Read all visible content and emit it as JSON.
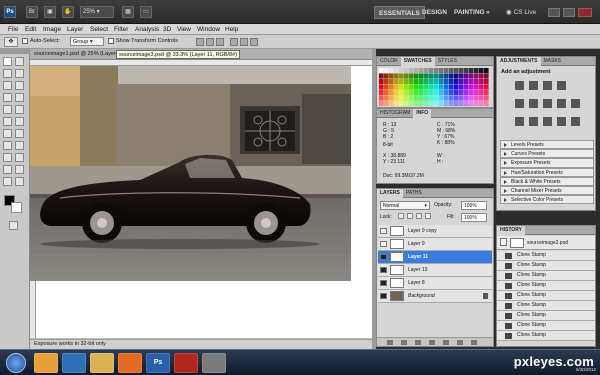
{
  "appbar": {
    "zoom": "25%",
    "workspaces": [
      "ESSENTIALS",
      "DESIGN",
      "PAINTING"
    ],
    "cs_live": "CS Live"
  },
  "menu": [
    "File",
    "Edit",
    "Image",
    "Layer",
    "Select",
    "Filter",
    "Analysis",
    "3D",
    "View",
    "Window",
    "Help"
  ],
  "options": {
    "auto_select_label": "Auto-Select:",
    "auto_select_value": "Group",
    "show_transform": "Show Transform Controls"
  },
  "document": {
    "tab_title": "sourceimage1.psd @ 25% (Layer 11, RGB/8#)",
    "tooltip": "sourceimage3.psd @ 33.3% (Layer 11, RGB/8#)",
    "status": "Exposure works in 32-bit only"
  },
  "swatches_panel": {
    "tabs": [
      "COLOR",
      "SWATCHES",
      "STYLES"
    ],
    "active": "SWATCHES"
  },
  "info_panel": {
    "tabs": [
      "HISTOGRAM",
      "INFO"
    ],
    "rgb": [
      [
        "R :",
        "13"
      ],
      [
        "G :",
        "5"
      ],
      [
        "B :",
        "2"
      ]
    ],
    "cmyk": [
      [
        "C :",
        "71%"
      ],
      [
        "M :",
        "68%"
      ],
      [
        "Y :",
        "67%"
      ],
      [
        "K :",
        "88%"
      ]
    ],
    "bits": "8-bit",
    "xy": [
      [
        "X :",
        "38.889"
      ],
      [
        "Y :",
        "23.111"
      ]
    ],
    "wh": [
      [
        "W :",
        ""
      ],
      [
        "H :",
        ""
      ]
    ],
    "doc": "Doc: 99.3M/37.2M"
  },
  "layers_panel": {
    "tabs": [
      "LAYERS",
      "PATHS"
    ],
    "blend_mode": "Normal",
    "opacity_label": "Opacity:",
    "opacity_value": "100%",
    "lock_label": "Lock:",
    "fill_label": "Fill:",
    "fill_value": "100%",
    "layers": [
      {
        "name": "Layer 9 copy",
        "visible": false,
        "selected": false
      },
      {
        "name": "Layer 9",
        "visible": false,
        "selected": false
      },
      {
        "name": "Layer 11",
        "visible": true,
        "selected": true
      },
      {
        "name": "Layer 13",
        "visible": true,
        "selected": false
      },
      {
        "name": "Layer 8",
        "visible": true,
        "selected": false
      },
      {
        "name": "Background",
        "visible": true,
        "selected": false
      }
    ]
  },
  "adjustments_panel": {
    "tabs": [
      "ADJUSTMENTS",
      "MASKS"
    ],
    "header": "Add an adjustment",
    "presets": [
      "Levels Presets",
      "Curves Presets",
      "Exposure Presets",
      "Hue/Saturation Presets",
      "Black & White Presets",
      "Channel Mixer Presets",
      "Selective Color Presets"
    ]
  },
  "history_panel": {
    "tab": "HISTORY",
    "snapshot": "sourceimage2.psd",
    "steps": [
      "Clone Stamp",
      "Clone Stamp",
      "Clone Stamp",
      "Clone Stamp",
      "Clone Stamp",
      "Clone Stamp",
      "Clone Stamp",
      "Clone Stamp",
      "Clone Stamp"
    ]
  },
  "taskbar": {
    "watermark": "pxleyes.com",
    "date": "6/30/2012"
  },
  "colors": {
    "selection_blue": "#3a7be0",
    "panel_gray": "#d6d6d6",
    "app_dark": "#2b2b2b"
  }
}
